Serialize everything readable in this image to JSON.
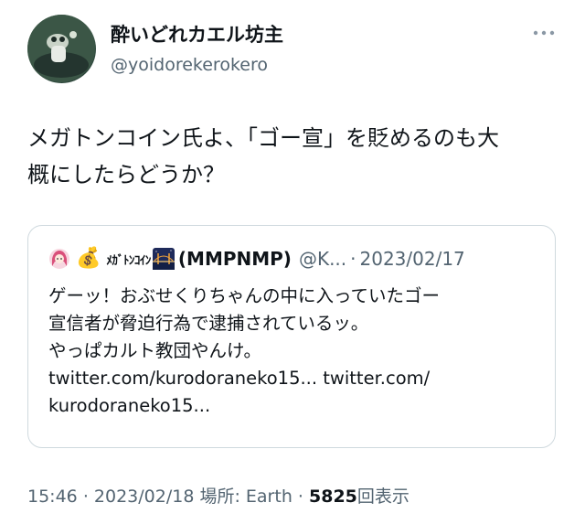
{
  "author": {
    "display_name": "酔いどれカエル坊主",
    "handle": "@yoidorekerokero"
  },
  "tweet": {
    "line1": "メガトンコイン氏よ、「ゴー宣」を貶めるのも大",
    "line2": "概にしたらどうか？"
  },
  "quote": {
    "icon_left": "anime-girl-avatar-icon",
    "emoji_money": "💰",
    "name_small": "ﾒｶﾞﾄﾝｺｲﾝ",
    "name_main": "(MMPNMP)",
    "handle": "@K...",
    "sep": "·",
    "date": "2023/02/17",
    "lines": [
      "ゲーッ！おぶせくりちゃんの中に入っていたゴー",
      "宣信者が脅迫行為で逮捕されているッ。",
      "やっぱカルト教団やんけ。",
      "twitter.com/kurodoraneko15... twitter.com/",
      "kurodoraneko15..."
    ]
  },
  "meta": {
    "time": "15:46",
    "sep1": "·",
    "date": "2023/02/18",
    "location": "場所: Earth",
    "sep2": "·",
    "views": "5825",
    "views_label": "回表示"
  }
}
